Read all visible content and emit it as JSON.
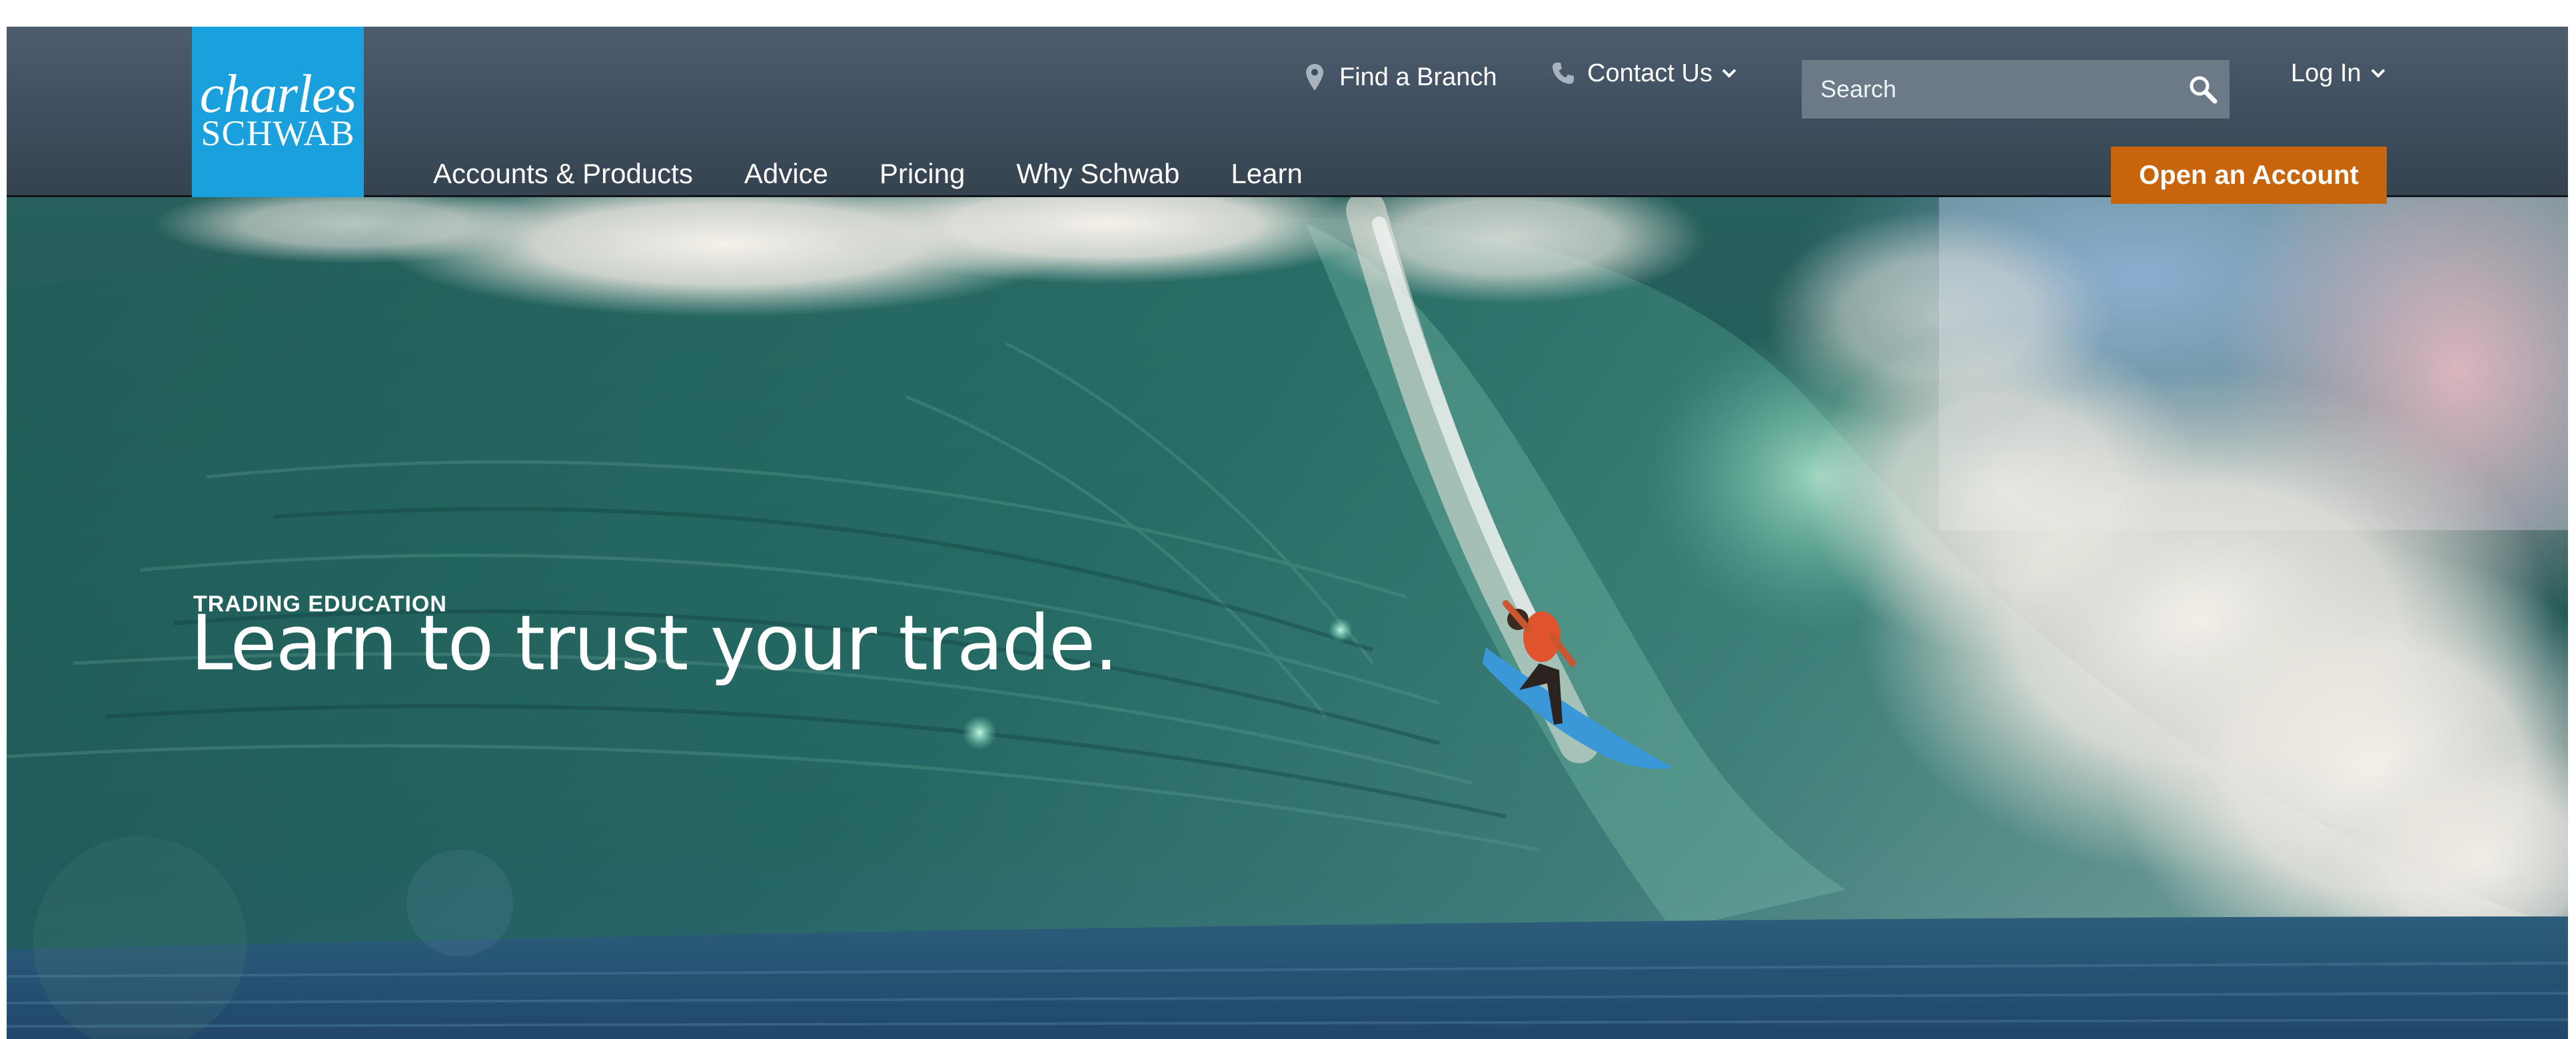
{
  "brand": {
    "logo_line1": "charles",
    "logo_line2": "SCHWAB",
    "logo_color": "#1aa1dd"
  },
  "utility": {
    "find_branch": "Find a Branch",
    "contact_us": "Contact Us",
    "login": "Log In",
    "search_placeholder": "Search",
    "icons": [
      "map-pin-icon",
      "phone-icon",
      "chevron-down-icon",
      "search-icon"
    ]
  },
  "nav": {
    "items": [
      {
        "label": "Accounts & Products"
      },
      {
        "label": "Advice"
      },
      {
        "label": "Pricing"
      },
      {
        "label": "Why Schwab"
      },
      {
        "label": "Learn"
      }
    ]
  },
  "cta": {
    "label": "Open an Account",
    "color": "#c8650c"
  },
  "hero": {
    "eyebrow": "TRADING EDUCATION",
    "headline": "Learn to trust your trade."
  },
  "colors": {
    "header_bg": "#3e4e5e",
    "search_bg": "#6c7a88"
  }
}
